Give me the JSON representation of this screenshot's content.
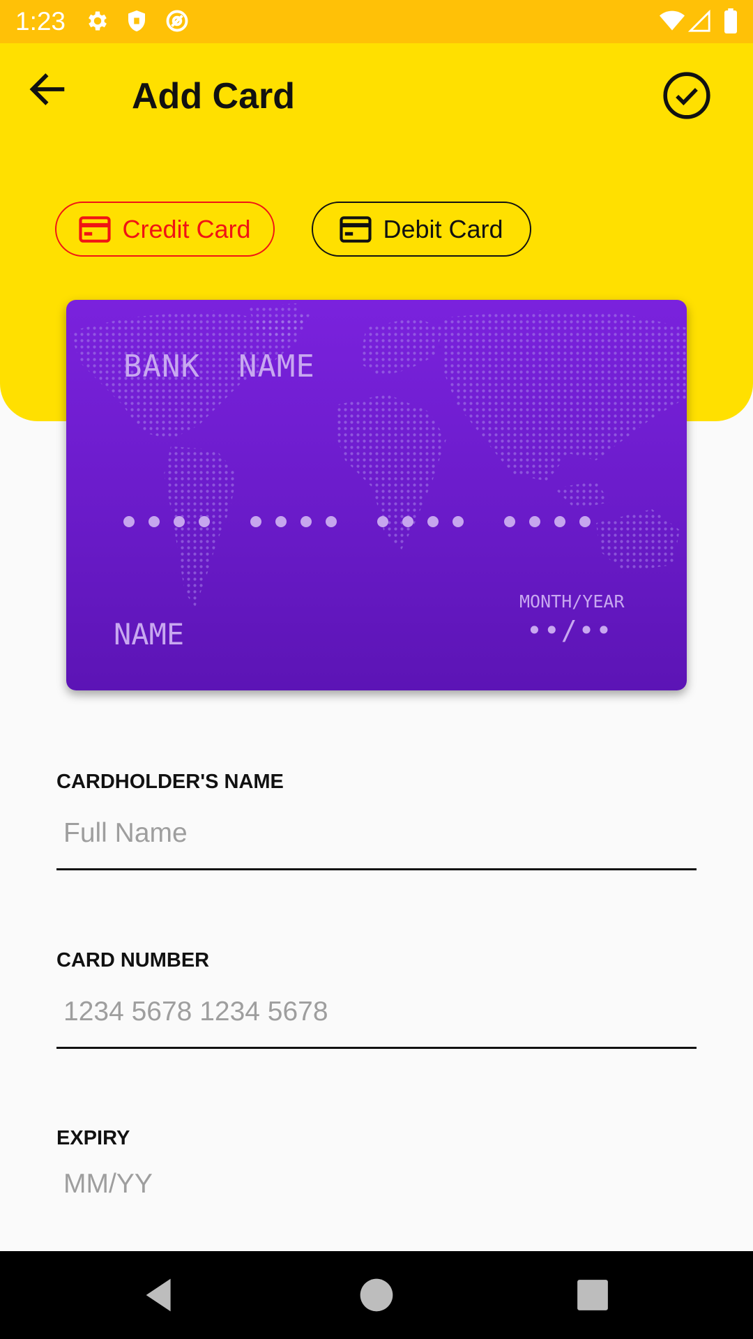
{
  "status_bar": {
    "time": "1:23",
    "icons": [
      "settings-icon",
      "shield-icon",
      "at-sign-icon",
      "wifi-icon",
      "signal-icon",
      "battery-icon"
    ],
    "background": "#ffc107"
  },
  "header": {
    "title": "Add Card",
    "background": "#ffe000",
    "back_icon": "arrow-left-icon",
    "confirm_icon": "check-circle-icon"
  },
  "card_types": [
    {
      "label": "Credit Card",
      "icon": "credit-card-icon",
      "selected": true
    },
    {
      "label": "Debit Card",
      "icon": "credit-card-icon",
      "selected": false
    }
  ],
  "card_preview": {
    "bank_name": "BANK  NAME",
    "holder_name": "NAME",
    "expiry_label": "MONTH/YEAR",
    "expiry_value": "••/••",
    "color": "#6a1bc9"
  },
  "form": {
    "name_label": "CARDHOLDER'S NAME",
    "name_placeholder": "Full Name",
    "number_label": "CARD NUMBER",
    "number_placeholder": "1234 5678 1234 5678",
    "expiry_label": "EXPIRY",
    "expiry_placeholder": "MM/YY"
  },
  "nav_bar": {
    "buttons": [
      "back-triangle-icon",
      "home-circle-icon",
      "recents-square-icon"
    ]
  },
  "colors": {
    "accent_selected": "#f01414",
    "text": "#111111",
    "placeholder": "#9e9e9e"
  }
}
